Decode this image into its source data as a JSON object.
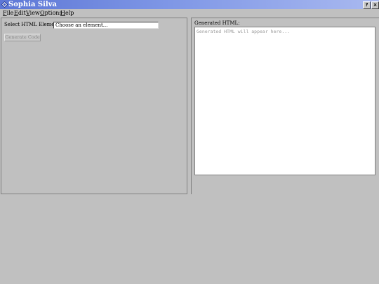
{
  "window": {
    "title": "Sophia Silva",
    "help_button": "?",
    "close_button": "×"
  },
  "menu": {
    "items": [
      {
        "label": "File"
      },
      {
        "label": "Edit"
      },
      {
        "label": "View"
      },
      {
        "label": "Options"
      },
      {
        "label": "Help"
      }
    ]
  },
  "left": {
    "select_label": "Select HTML Element:",
    "select_value": "Choose an element...",
    "generate_button": "Generate Code",
    "generate_enabled": false
  },
  "right": {
    "output_label": "Generated HTML:",
    "output_placeholder": "Generated HTML will appear here..."
  },
  "colors": {
    "titlebar_start": "#5d77d6",
    "titlebar_end": "#a9b9f0",
    "window_bg": "#c0c0c0"
  },
  "icons": {
    "app": "diamond-app-icon"
  }
}
